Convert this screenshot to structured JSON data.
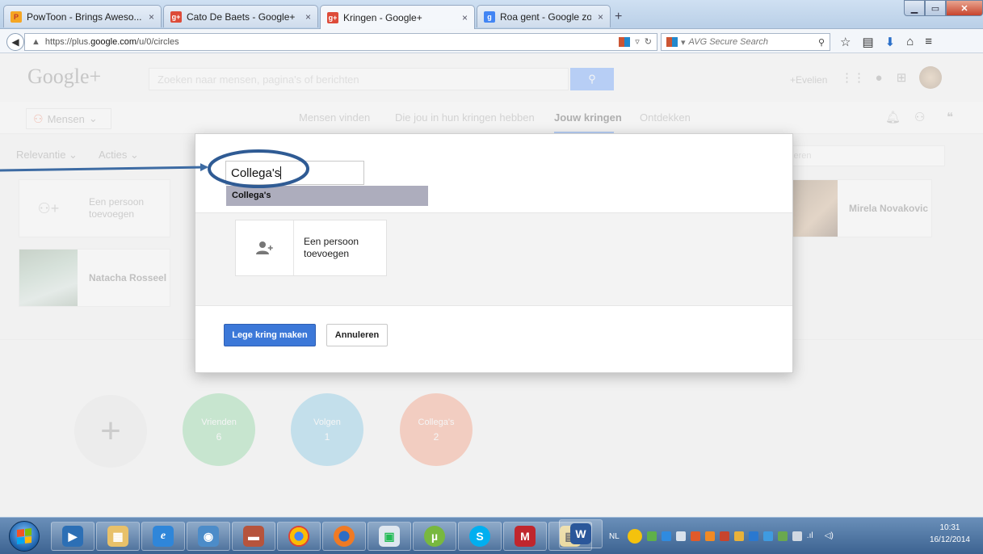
{
  "browser": {
    "tabs": [
      {
        "title": "PowToon - Brings Aweso...",
        "close": "×"
      },
      {
        "title": "Cato De Baets - Google+",
        "close": "×"
      },
      {
        "title": "Kringen - Google+",
        "close": "×"
      },
      {
        "title": "Roa gent - Google zoeken",
        "close": "×"
      }
    ],
    "new_tab": "+",
    "url_prefix": "https://plus.",
    "url_domain": "google.com",
    "url_path": "/u/0/circles",
    "search_placeholder": "AVG Secure Search"
  },
  "gplus": {
    "logo": "Google+",
    "search_placeholder": "Zoeken naar mensen, pagina's of berichten",
    "user": "+Evelien",
    "people_menu": "Mensen",
    "nav": [
      "Mensen vinden",
      "Die jou in hun kringen hebben",
      "Jouw kringen",
      "Ontdekken"
    ],
    "filters": [
      "Relevantie",
      "Acties"
    ],
    "filter_search": "en invoeren",
    "cards": {
      "add_person": "Een persoon toevoegen",
      "natacha": "Natacha Rosseel",
      "mirela": "Mirela Novakovic"
    },
    "circles": [
      {
        "name": "Vrienden",
        "count": "6",
        "color": "#7bcf93"
      },
      {
        "name": "Volgen",
        "count": "1",
        "color": "#6fbfe0"
      },
      {
        "name": "Collega's",
        "count": "2",
        "color": "#f48c6a"
      }
    ]
  },
  "dialog": {
    "circle_name_value": "Collega's",
    "suggestion": "Collega's",
    "add_person_label": "Een persoon toevoegen",
    "create_button": "Lege kring maken",
    "cancel_button": "Annuleren"
  },
  "taskbar": {
    "language": "NL",
    "time": "10:31",
    "date": "16/12/2014"
  }
}
